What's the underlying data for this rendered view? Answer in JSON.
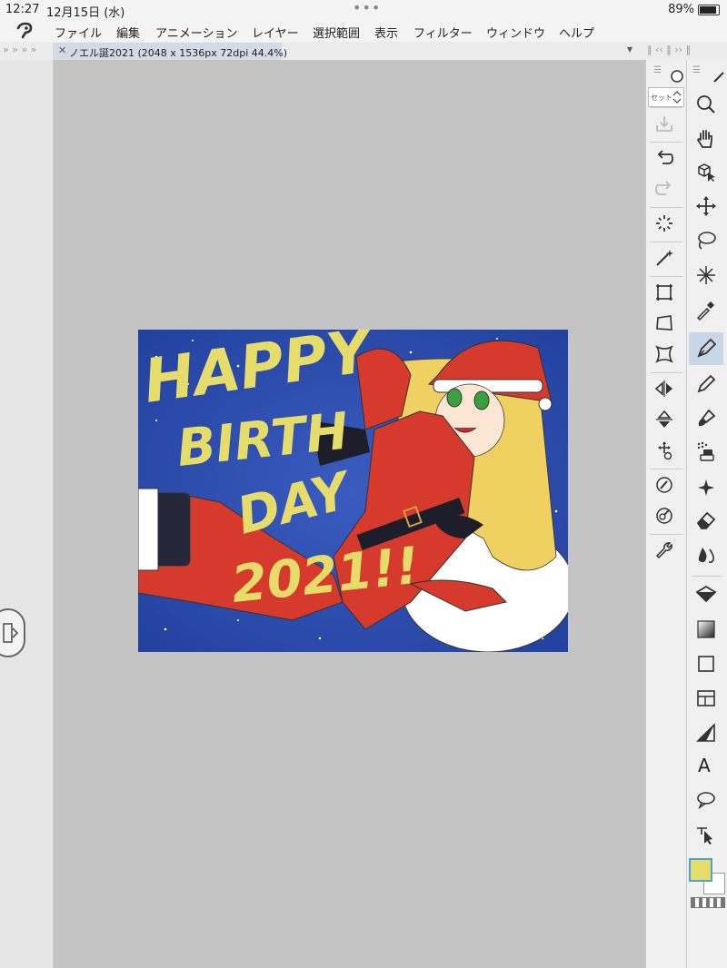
{
  "status": {
    "time": "12:27",
    "date": "12月15日 (水)",
    "battery": "89%"
  },
  "menu": {
    "items": [
      "ファイル",
      "編集",
      "アニメーション",
      "レイヤー",
      "選択範囲",
      "表示",
      "フィルター",
      "ウィンドウ",
      "ヘルプ"
    ]
  },
  "document": {
    "tab_title": "ノエル誕2021 (2048 x 1536px 72dpi 44.4%)"
  },
  "subtool": {
    "set_label": "セット"
  },
  "tools": [
    "zoom",
    "hand",
    "object-select",
    "move-layer",
    "lasso-selection",
    "magic-wand",
    "eyedropper",
    "pen",
    "pencil",
    "brush",
    "airbrush",
    "decoration",
    "eraser",
    "blend",
    "fill",
    "gradient",
    "figure",
    "frame-border",
    "ruler",
    "text",
    "balloon",
    "correct-line"
  ],
  "active_tool": "pen",
  "text_tool_glyph": "A",
  "colors": {
    "main": "#e6dc6a",
    "sub": "#ffffff",
    "accent": "#4aa3d8",
    "canvas_bg": "#c4c4c4",
    "art_bg": "#2b4aa8"
  },
  "artwork": {
    "text_lines": [
      "HAPPY",
      "BIRTH",
      "DAY",
      "2021!!"
    ]
  }
}
